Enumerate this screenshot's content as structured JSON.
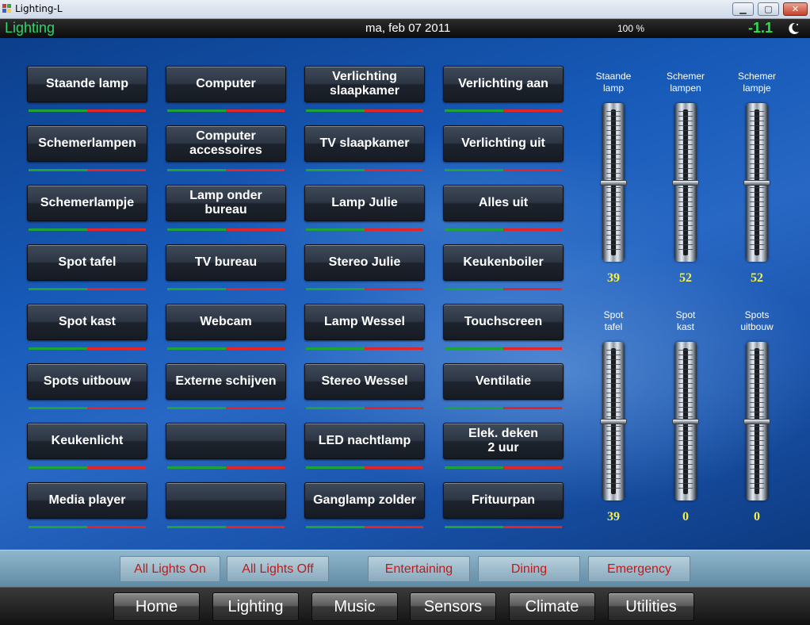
{
  "window": {
    "title": "Lighting-L"
  },
  "header": {
    "app_title": "Lighting",
    "date": "ma, feb 07 2011",
    "percent": "100 %",
    "temperature": "-1.1",
    "mode_icon": "moon-icon"
  },
  "lights": {
    "columns": [
      [
        "Staande lamp",
        "Schemerlampen",
        "Schemerlampje",
        "Spot tafel",
        "Spot kast",
        "Spots uitbouw",
        "Keukenlicht",
        "Media player"
      ],
      [
        "Computer",
        "Computer\naccessoires",
        "Lamp onder\nbureau",
        "TV bureau",
        "Webcam",
        "Externe schijven",
        "",
        ""
      ],
      [
        "Verlichting\nslaapkamer",
        "TV slaapkamer",
        "Lamp Julie",
        "Stereo Julie",
        "Lamp Wessel",
        "Stereo Wessel",
        "LED nachtlamp",
        "Ganglamp zolder"
      ],
      [
        "Verlichting aan",
        "Verlichting uit",
        "Alles uit",
        "Keukenboiler",
        "Touchscreen",
        "Ventilatie",
        "Elek. deken\n2 uur",
        "Frituurpan"
      ]
    ]
  },
  "dimmers": [
    {
      "label": "Staande\nlamp",
      "value": "39",
      "level": 0.5
    },
    {
      "label": "Schemer\nlampen",
      "value": "52",
      "level": 0.5
    },
    {
      "label": "Schemer\nlampje",
      "value": "52",
      "level": 0.5
    },
    {
      "label": "Spot\ntafel",
      "value": "39",
      "level": 0.5
    },
    {
      "label": "Spot\nkast",
      "value": "0",
      "level": 0.5
    },
    {
      "label": "Spots\nuitbouw",
      "value": "0",
      "level": 0.5
    }
  ],
  "scenes": {
    "all_on": "All Lights On",
    "all_off": "All Lights Off",
    "entertaining": "Entertaining",
    "dining": "Dining",
    "emergency": "Emergency"
  },
  "nav": {
    "home": "Home",
    "lighting": "Lighting",
    "music": "Music",
    "sensors": "Sensors",
    "climate": "Climate",
    "utilities": "Utilities"
  },
  "colors": {
    "accent_green": "#2fd56a",
    "temp_green": "#2fe04d",
    "value_yellow": "#f5f04a",
    "scene_text_red": "#c01a1a",
    "indicator_green": "#1ea33a",
    "indicator_red": "#e0262a"
  }
}
